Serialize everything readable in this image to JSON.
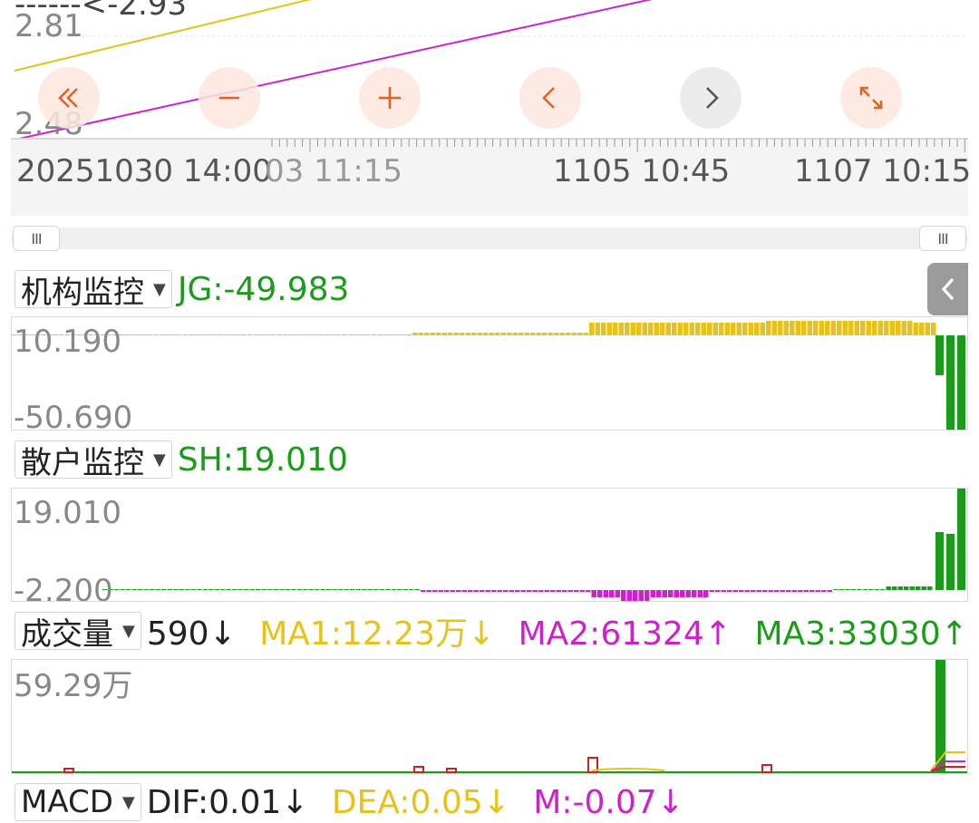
{
  "price_chart": {
    "annotation": "------<-2.93",
    "top_label": "2.81",
    "bottom_label": "2.48",
    "line_colors": {
      "ma_yellow": "#e8c21a",
      "ma_magenta": "#cc22cc"
    }
  },
  "nav_buttons": [
    {
      "icon": "double-chevron-left-icon"
    },
    {
      "icon": "minus-icon"
    },
    {
      "icon": "plus-icon"
    },
    {
      "icon": "chevron-left-icon"
    },
    {
      "icon": "chevron-right-icon"
    },
    {
      "icon": "expand-icon"
    }
  ],
  "time_axis": {
    "start": "20251030 14:00",
    "overlap": "03 11:15",
    "mid": "1105 10:45",
    "end": "1107 10:15"
  },
  "range_slider": {
    "handle_glyph": "III"
  },
  "indicators": {
    "jg": {
      "selector": "机构监控",
      "value": "JG:-49.983",
      "top_label": "10.190",
      "bottom_label": "-50.690",
      "color": "#1a9c1a"
    },
    "sh": {
      "selector": "散户监控",
      "value": "SH:19.010",
      "top_label": "19.010",
      "bottom_label": "-2.200",
      "color": "#1a9c1a"
    },
    "volume": {
      "selector": "成交量",
      "vol": "590↓",
      "ma1": "MA1:12.23万↓",
      "ma2": "MA2:61324↑",
      "ma3": "MA3:33030↑",
      "top_label": "59.29万"
    },
    "macd": {
      "selector": "MACD",
      "dif": "DIF:0.01↓",
      "dea": "DEA:0.05↓",
      "m": "M:-0.07↓"
    }
  },
  "colors": {
    "yellow": "#e8c21a",
    "magenta": "#cc22cc",
    "green": "#1a9c1a",
    "red": "#cc2222",
    "accent_orange": "#e0622a"
  }
}
